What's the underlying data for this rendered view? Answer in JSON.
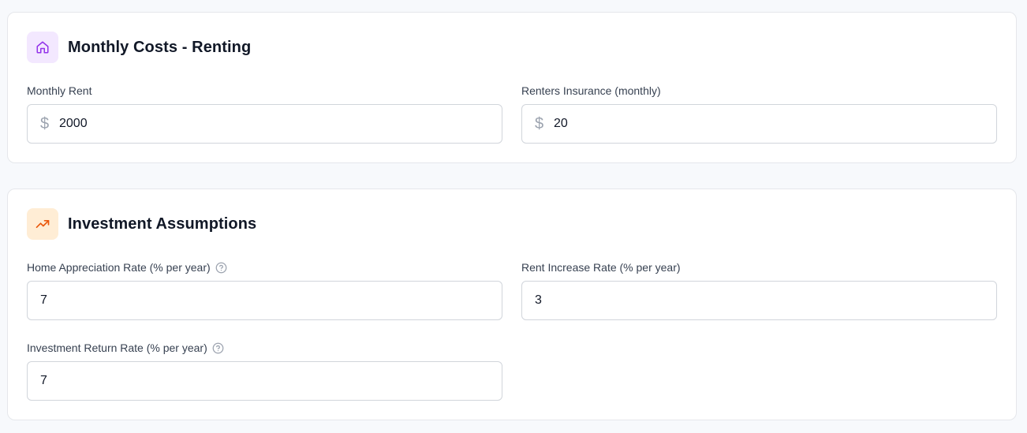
{
  "renting_section": {
    "title": "Monthly Costs - Renting",
    "icon": "home-icon",
    "accent": "#9333ea",
    "fields": {
      "monthly_rent": {
        "label": "Monthly Rent",
        "prefix": "$",
        "value": "2000"
      },
      "renters_insurance": {
        "label": "Renters Insurance (monthly)",
        "prefix": "$",
        "value": "20"
      }
    }
  },
  "investment_section": {
    "title": "Investment Assumptions",
    "icon": "trending-up-icon",
    "accent": "#ea580c",
    "fields": {
      "home_appreciation": {
        "label": "Home Appreciation Rate (% per year)",
        "value": "7",
        "has_help": true
      },
      "rent_increase": {
        "label": "Rent Increase Rate (% per year)",
        "value": "3",
        "has_help": false
      },
      "investment_return": {
        "label": "Investment Return Rate (% per year)",
        "value": "7",
        "has_help": true
      }
    }
  }
}
